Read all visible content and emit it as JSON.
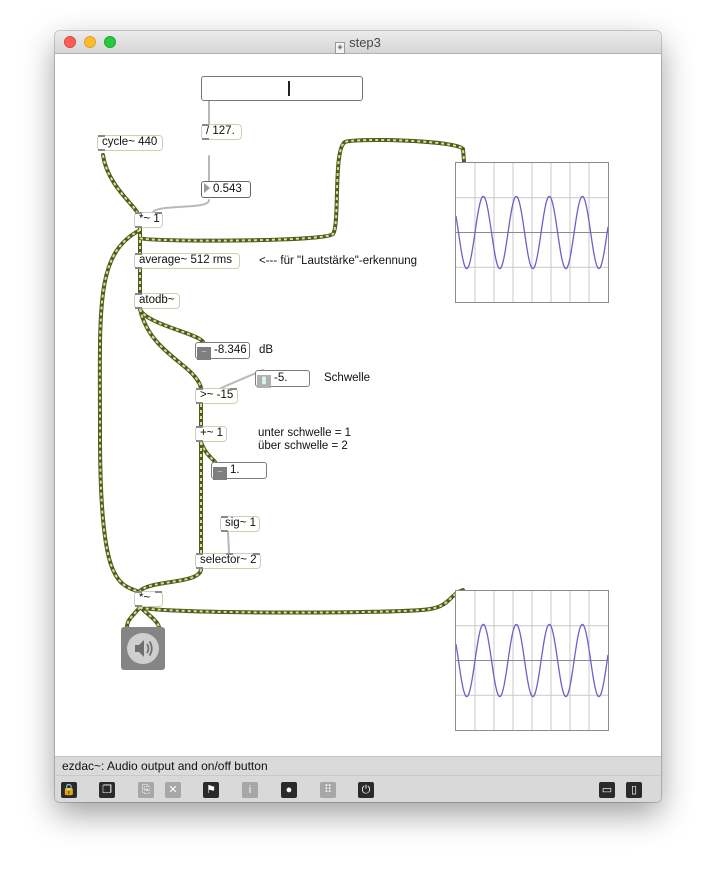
{
  "window": {
    "title": "step3"
  },
  "objects": {
    "cycle": "cycle~ 440",
    "div127": "/ 127.",
    "mult1": "*~ 1",
    "average": "average~ 512 rms",
    "atodb": "atodb~",
    "greater": ">~ -15",
    "plus1": "+~ 1",
    "sig1": "sig~ 1",
    "selector": "selector~ 2",
    "mult2": "*~"
  },
  "number_boxes": {
    "gain_value": "0.543",
    "db_value": "-8.346",
    "threshold_value": "-5.",
    "plus_out_value": "1."
  },
  "comments": {
    "loudness": "<--- für \"Lautstärke\"-erkennung",
    "db": "dB",
    "threshold": "Schwelle",
    "below": "unter schwelle = 1",
    "above": "über schwelle = 2"
  },
  "slider": {
    "value_fraction": 0.543
  },
  "scopes": [
    {
      "name": "scope-top",
      "cycles": 4.6
    },
    {
      "name": "scope-bottom",
      "cycles": 4.6
    }
  ],
  "statusbar": {
    "text": "ezdac~: Audio output and on/off button"
  },
  "toolbar": {
    "items": [
      {
        "icon": "lock-icon",
        "enabled": true
      },
      {
        "icon": "presentation-icon",
        "enabled": true
      },
      {
        "icon": "paste-icon",
        "enabled": false
      },
      {
        "icon": "delete-icon",
        "enabled": false
      },
      {
        "icon": "debug-icon",
        "enabled": true
      },
      {
        "icon": "info-icon",
        "enabled": false
      },
      {
        "icon": "object-icon",
        "enabled": true
      },
      {
        "icon": "grid-icon",
        "enabled": false
      },
      {
        "icon": "audio-dsp-icon",
        "enabled": true
      },
      {
        "icon": "bottom-panel-icon",
        "enabled": true
      },
      {
        "icon": "right-panel-icon",
        "enabled": true
      }
    ]
  },
  "colors": {
    "patchcord_signal": "#4f5a24",
    "patchcord_signal_stripe": "#d6e48a",
    "patchcord_control": "#b8b8b8",
    "scope_trace": "#6a62c8",
    "object_border": "#c9d3b1"
  }
}
